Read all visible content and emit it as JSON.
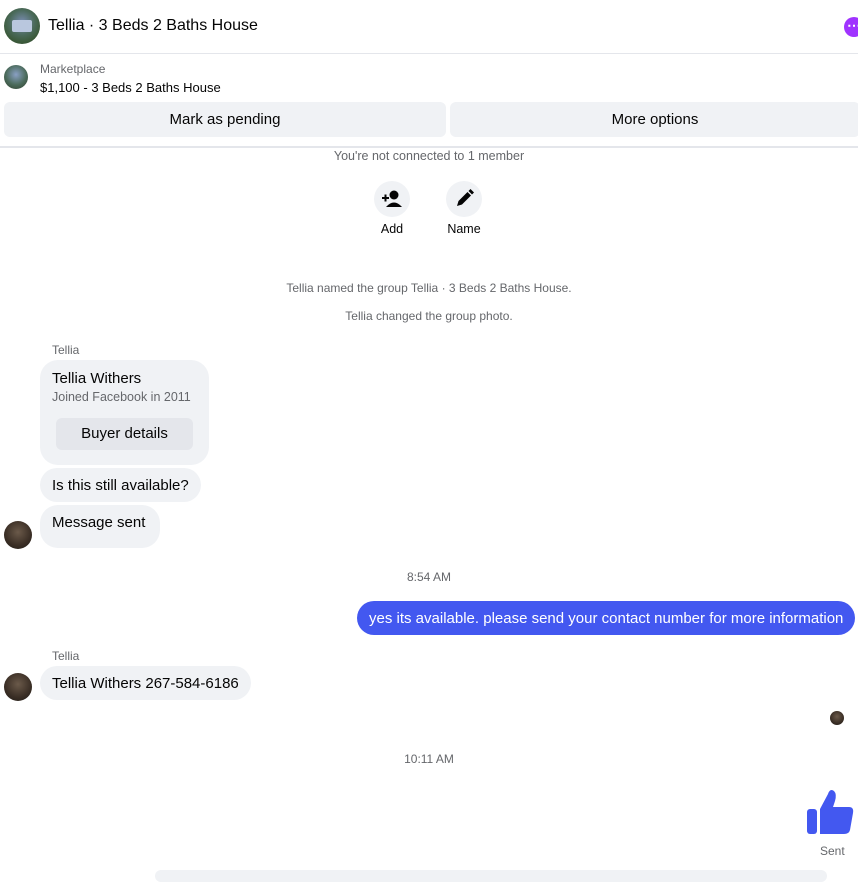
{
  "header": {
    "title": "Tellia · 3 Beds 2 Baths House"
  },
  "marketplace": {
    "label": "Marketplace",
    "listing": "$1,100 - 3 Beds 2 Baths House"
  },
  "actions": {
    "pending": "Mark as pending",
    "more": "More options"
  },
  "info": {
    "not_connected": "You're not connected to 1 member",
    "add": "Add",
    "name": "Name"
  },
  "system": {
    "named": "Tellia named the group Tellia · 3 Beds 2 Baths House.",
    "photo": "Tellia changed the group photo."
  },
  "messages": {
    "sender": "Tellia",
    "card_name": "Tellia Withers",
    "card_sub": "Joined Facebook in 2011",
    "card_button": "Buyer details",
    "m1": "Is this still available?",
    "m2": "Message sent",
    "time1": "8:54 AM",
    "out1": "yes its available. please send your contact number for more information",
    "sender2": "Tellia",
    "m3": "Tellia Withers 267-584-6186",
    "time2": "10:11 AM",
    "sent": "Sent"
  },
  "colors": {
    "accent": "#4358f0",
    "more_dot": "#a033ff"
  }
}
